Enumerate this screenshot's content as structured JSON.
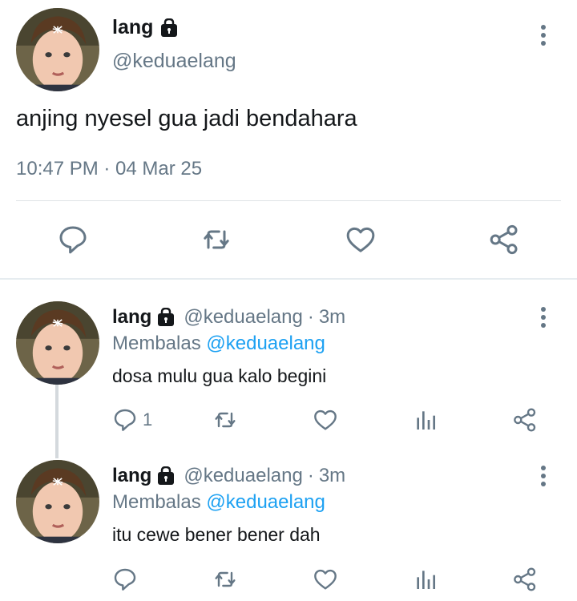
{
  "colors": {
    "text": "#14171a",
    "muted": "#657786",
    "link": "#1da1f2",
    "divider": "#e6ecf0"
  },
  "main_tweet": {
    "name": "lang",
    "handle": "@keduaelang",
    "text": "anjing nyesel gua jadi bendahara",
    "timestamp": "10:47 PM · 04 Mar 25",
    "icons": [
      "reply-icon",
      "retweet-icon",
      "like-icon",
      "share-icon"
    ]
  },
  "replies": [
    {
      "name": "lang",
      "handle": "@keduaelang",
      "separator": "·",
      "age": "3m",
      "replying_prefix": "Membalas",
      "replying_to": "@keduaelang",
      "text": "dosa mulu gua kalo begini",
      "reply_count": "1"
    },
    {
      "name": "lang",
      "handle": "@keduaelang",
      "separator": "·",
      "age": "3m",
      "replying_prefix": "Membalas",
      "replying_to": "@keduaelang",
      "text": "itu cewe bener bener dah",
      "reply_count": ""
    }
  ]
}
